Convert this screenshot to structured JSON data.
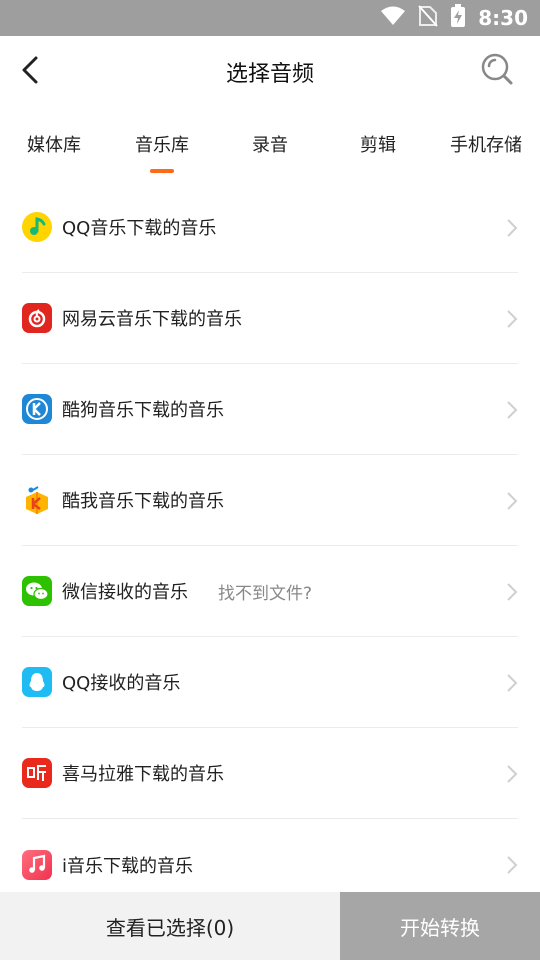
{
  "status_bar": {
    "time": "8:30"
  },
  "header": {
    "title": "选择音频",
    "back_icon": "back-arrow-icon",
    "search_icon": "search-icon"
  },
  "tabs": [
    {
      "label": "媒体库",
      "active": false
    },
    {
      "label": "音乐库",
      "active": true
    },
    {
      "label": "录音",
      "active": false
    },
    {
      "label": "剪辑",
      "active": false
    },
    {
      "label": "手机存储",
      "active": false
    }
  ],
  "accent_color": "#ff6a1a",
  "sources": [
    {
      "label": "QQ音乐下载的音乐",
      "icon": "qq-music-icon"
    },
    {
      "label": "网易云音乐下载的音乐",
      "icon": "netease-music-icon"
    },
    {
      "label": "酷狗音乐下载的音乐",
      "icon": "kugou-icon"
    },
    {
      "label": "酷我音乐下载的音乐",
      "icon": "kuwo-icon"
    },
    {
      "label": "微信接收的音乐",
      "icon": "wechat-icon",
      "hint": "找不到文件?"
    },
    {
      "label": "QQ接收的音乐",
      "icon": "qq-icon"
    },
    {
      "label": "喜马拉雅下载的音乐",
      "icon": "ximalaya-icon"
    },
    {
      "label": "i音乐下载的音乐",
      "icon": "i-music-icon"
    }
  ],
  "bottom": {
    "view_selected": "查看已选择(0)",
    "start_convert": "开始转换"
  }
}
